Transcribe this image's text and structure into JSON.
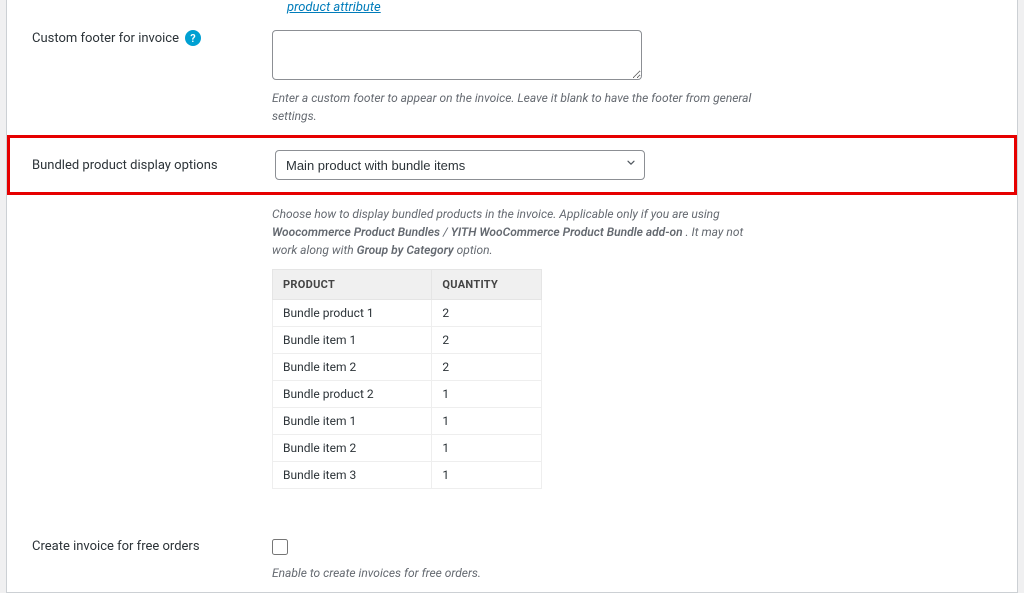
{
  "top_link": "product attribute",
  "footer_row": {
    "label": "Custom footer for invoice",
    "value": "",
    "help": "?",
    "desc": "Enter a custom footer to appear on the invoice. Leave it blank to have the footer from general settings."
  },
  "bundle_row": {
    "label": "Bundled product display options",
    "selected": "Main product with bundle items",
    "desc_pre": "Choose how to display bundled products in the invoice. Applicable only if you are using ",
    "bold1": "Woocommerce Product Bundles",
    "sep1": " / ",
    "bold2": "YITH WooCommerce Product Bundle add-on",
    "mid": " . It may not work along with ",
    "bold3": "Group by Category",
    "post": " option."
  },
  "table": {
    "h1": "PRODUCT",
    "h2": "QUANTITY",
    "rows": [
      {
        "p": "Bundle product 1",
        "q": "2",
        "indent": false
      },
      {
        "p": "Bundle item 1",
        "q": "2",
        "indent": true
      },
      {
        "p": "Bundle item 2",
        "q": "2",
        "indent": true
      },
      {
        "p": "Bundle product 2",
        "q": "1",
        "indent": false
      },
      {
        "p": "Bundle item 1",
        "q": "1",
        "indent": true
      },
      {
        "p": "Bundle item 2",
        "q": "1",
        "indent": true
      },
      {
        "p": "Bundle item 3",
        "q": "1",
        "indent": true
      }
    ]
  },
  "free_row": {
    "label": "Create invoice for free orders",
    "checked": false,
    "desc": "Enable to create invoices for free orders."
  }
}
